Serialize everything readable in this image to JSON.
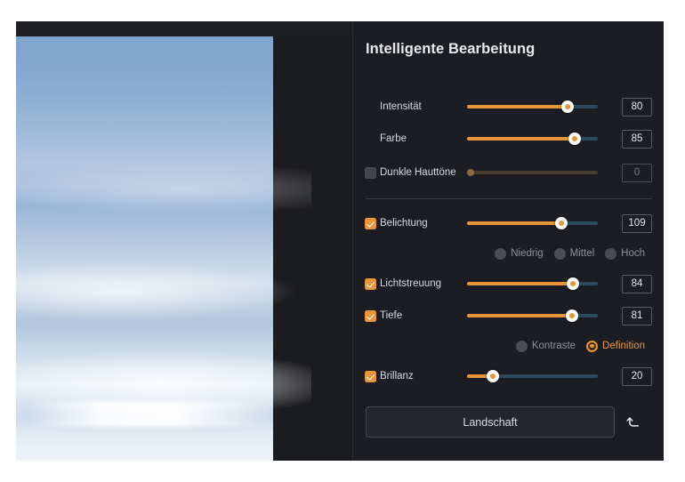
{
  "panel": {
    "title": "Intelligente Bearbeitung"
  },
  "controls": [
    {
      "label": "Intensität",
      "value": "80",
      "percent": 77,
      "enabled": true,
      "has_checkbox": false,
      "checked": false
    },
    {
      "label": "Farbe",
      "value": "85",
      "percent": 82,
      "enabled": true,
      "has_checkbox": false,
      "checked": false
    },
    {
      "label": "Dunkle Hauttöne",
      "value": "0",
      "percent": 3,
      "enabled": false,
      "has_checkbox": true,
      "checked": false
    },
    {
      "label": "Belichtung",
      "value": "109",
      "percent": 72,
      "enabled": true,
      "has_checkbox": true,
      "checked": true
    },
    {
      "label": "Lichtstreuung",
      "value": "84",
      "percent": 81,
      "enabled": true,
      "has_checkbox": true,
      "checked": true
    },
    {
      "label": "Tiefe",
      "value": "81",
      "percent": 80,
      "enabled": true,
      "has_checkbox": true,
      "checked": true
    },
    {
      "label": "Brillanz",
      "value": "20",
      "percent": 20,
      "enabled": true,
      "has_checkbox": true,
      "checked": true
    }
  ],
  "radio_group_level": {
    "options": [
      {
        "label": "Niedrig",
        "selected": false
      },
      {
        "label": "Mittel",
        "selected": false
      },
      {
        "label": "Hoch",
        "selected": false
      }
    ]
  },
  "radio_group_mode": {
    "options": [
      {
        "label": "Kontraste",
        "selected": false
      },
      {
        "label": "Definition",
        "selected": true
      }
    ]
  },
  "footer": {
    "preset_label": "Landschaft",
    "reset_icon": "undo-arrow-icon"
  },
  "colors": {
    "accent": "#e8953a",
    "panel_background": "#1c1d22",
    "track": "#2c4a5e",
    "text": "#d7dae0"
  }
}
